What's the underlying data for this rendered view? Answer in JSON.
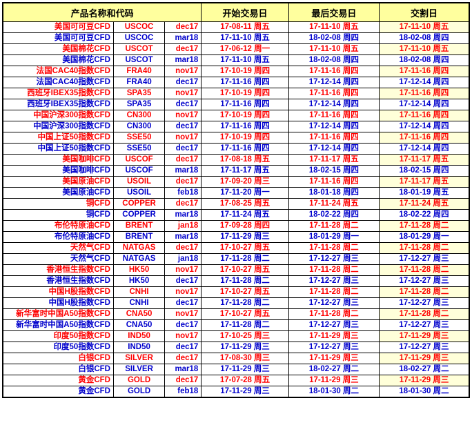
{
  "table": {
    "headers": {
      "product": "产品名称和代码",
      "start_trading_day": "开始交易日",
      "last_trading_day": "最后交易日",
      "settlement_day": "交割日"
    },
    "rows": [
      {
        "name": "美国可可豆CFD",
        "symbol": "USCOC",
        "month": "dec17",
        "start": "17-08-11 周五",
        "last": "17-11-10 周五",
        "settle": "17-11-10 周五",
        "color": "red"
      },
      {
        "name": "美国可可豆CFD",
        "symbol": "USCOC",
        "month": "mar18",
        "start": "17-11-10 周五",
        "last": "18-02-08 周四",
        "settle": "18-02-08 周四",
        "color": "blue"
      },
      {
        "name": "美国棉花CFD",
        "symbol": "USCOT",
        "month": "dec17",
        "start": "17-06-12 周一",
        "last": "17-11-10 周五",
        "settle": "17-11-10 周五",
        "color": "red"
      },
      {
        "name": "美国棉花CFD",
        "symbol": "USCOT",
        "month": "mar18",
        "start": "17-11-10 周五",
        "last": "18-02-08 周四",
        "settle": "18-02-08 周四",
        "color": "blue"
      },
      {
        "name": "法国CAC40指数CFD",
        "symbol": "FRA40",
        "month": "nov17",
        "start": "17-10-19 周四",
        "last": "17-11-16 周四",
        "settle": "17-11-16 周四",
        "color": "red"
      },
      {
        "name": "法国CAC40指数CFD",
        "symbol": "FRA40",
        "month": "dec17",
        "start": "17-11-16 周四",
        "last": "17-12-14 周四",
        "settle": "17-12-14 周四",
        "color": "blue"
      },
      {
        "name": "西班牙IBEX35指数CFD",
        "symbol": "SPA35",
        "month": "nov17",
        "start": "17-10-19 周四",
        "last": "17-11-16 周四",
        "settle": "17-11-16 周四",
        "color": "red"
      },
      {
        "name": "西班牙IBEX35指数CFD",
        "symbol": "SPA35",
        "month": "dec17",
        "start": "17-11-16 周四",
        "last": "17-12-14 周四",
        "settle": "17-12-14 周四",
        "color": "blue"
      },
      {
        "name": "中国沪深300指数CFD",
        "symbol": "CN300",
        "month": "nov17",
        "start": "17-10-19 周四",
        "last": "17-11-16 周四",
        "settle": "17-11-16 周四",
        "color": "red"
      },
      {
        "name": "中国沪深300指数CFD",
        "symbol": "CN300",
        "month": "dec17",
        "start": "17-11-16 周四",
        "last": "17-12-14 周四",
        "settle": "17-12-14 周四",
        "color": "blue"
      },
      {
        "name": "中国上证50指数CFD",
        "symbol": "SSE50",
        "month": "nov17",
        "start": "17-10-19 周四",
        "last": "17-11-16 周四",
        "settle": "17-11-16 周四",
        "color": "red"
      },
      {
        "name": "中国上证50指数CFD",
        "symbol": "SSE50",
        "month": "dec17",
        "start": "17-11-16 周四",
        "last": "17-12-14 周四",
        "settle": "17-12-14 周四",
        "color": "blue"
      },
      {
        "name": "美国咖啡CFD",
        "symbol": "USCOF",
        "month": "dec17",
        "start": "17-08-18 周五",
        "last": "17-11-17 周五",
        "settle": "17-11-17 周五",
        "color": "red"
      },
      {
        "name": "美国咖啡CFD",
        "symbol": "USCOF",
        "month": "mar18",
        "start": "17-11-17 周五",
        "last": "18-02-15 周四",
        "settle": "18-02-15 周四",
        "color": "blue"
      },
      {
        "name": "美国原油CFD",
        "symbol": "USOIL",
        "month": "dec17",
        "start": "17-09-20 周三",
        "last": "17-11-16 周四",
        "settle": "17-11-17 周五",
        "color": "red"
      },
      {
        "name": "美国原油CFD",
        "symbol": "USOIL",
        "month": "feb18",
        "start": "17-11-20 周一",
        "last": "18-01-18 周四",
        "settle": "18-01-19 周五",
        "color": "blue"
      },
      {
        "name": "铜CFD",
        "symbol": "COPPER",
        "month": "dec17",
        "start": "17-08-25 周五",
        "last": "17-11-24 周五",
        "settle": "17-11-24 周五",
        "color": "red"
      },
      {
        "name": "铜CFD",
        "symbol": "COPPER",
        "month": "mar18",
        "start": "17-11-24 周五",
        "last": "18-02-22 周四",
        "settle": "18-02-22 周四",
        "color": "blue"
      },
      {
        "name": "布伦特原油CFD",
        "symbol": "BRENT",
        "month": "jan18",
        "start": "17-09-28 周四",
        "last": "17-11-28 周二",
        "settle": "17-11-28 周二",
        "color": "red"
      },
      {
        "name": "布伦特原油CFD",
        "symbol": "BRENT",
        "month": "mar18",
        "start": "17-11-29 周三",
        "last": "18-01-29 周一",
        "settle": "18-01-29 周一",
        "color": "blue"
      },
      {
        "name": "天然气CFD",
        "symbol": "NATGAS",
        "month": "dec17",
        "start": "17-10-27 周五",
        "last": "17-11-28 周二",
        "settle": "17-11-28 周二",
        "color": "red"
      },
      {
        "name": "天然气CFD",
        "symbol": "NATGAS",
        "month": "jan18",
        "start": "17-11-28 周二",
        "last": "17-12-27 周三",
        "settle": "17-12-27 周三",
        "color": "blue"
      },
      {
        "name": "香港恒生指数CFD",
        "symbol": "HK50",
        "month": "nov17",
        "start": "17-10-27 周五",
        "last": "17-11-28 周二",
        "settle": "17-11-28 周二",
        "color": "red"
      },
      {
        "name": "香港恒生指数CFD",
        "symbol": "HK50",
        "month": "dec17",
        "start": "17-11-28 周二",
        "last": "17-12-27 周三",
        "settle": "17-12-27 周三",
        "color": "blue"
      },
      {
        "name": "中国H股指数CFD",
        "symbol": "CNHI",
        "month": "nov17",
        "start": "17-10-27 周五",
        "last": "17-11-28 周二",
        "settle": "17-11-28 周二",
        "color": "red"
      },
      {
        "name": "中国H股指数CFD",
        "symbol": "CNHI",
        "month": "dec17",
        "start": "17-11-28 周二",
        "last": "17-12-27 周三",
        "settle": "17-12-27 周三",
        "color": "blue"
      },
      {
        "name": "新华富时中国A50指数CFD",
        "symbol": "CNA50",
        "month": "nov17",
        "start": "17-10-27 周五",
        "last": "17-11-28 周二",
        "settle": "17-11-28 周二",
        "color": "red"
      },
      {
        "name": "新华富时中国A50指数CFD",
        "symbol": "CNA50",
        "month": "dec17",
        "start": "17-11-28 周二",
        "last": "17-12-27 周三",
        "settle": "17-12-27 周三",
        "color": "blue"
      },
      {
        "name": "印度50指数CFD",
        "symbol": "IND50",
        "month": "nov17",
        "start": "17-10-25 周三",
        "last": "17-11-29 周三",
        "settle": "17-11-29 周三",
        "color": "red"
      },
      {
        "name": "印度50指数CFD",
        "symbol": "IND50",
        "month": "dec17",
        "start": "17-11-29 周三",
        "last": "17-12-27 周三",
        "settle": "17-12-27 周三",
        "color": "blue"
      },
      {
        "name": "白银CFD",
        "symbol": "SILVER",
        "month": "dec17",
        "start": "17-08-30 周三",
        "last": "17-11-29 周三",
        "settle": "17-11-29 周三",
        "color": "red"
      },
      {
        "name": "白银CFD",
        "symbol": "SILVER",
        "month": "mar18",
        "start": "17-11-29 周三",
        "last": "18-02-27 周二",
        "settle": "18-02-27 周二",
        "color": "blue"
      },
      {
        "name": "黄金CFD",
        "symbol": "GOLD",
        "month": "dec17",
        "start": "17-07-28 周五",
        "last": "17-11-29 周三",
        "settle": "17-11-29 周三",
        "color": "red"
      },
      {
        "name": "黄金CFD",
        "symbol": "GOLD",
        "month": "feb18",
        "start": "17-11-29 周三",
        "last": "18-01-30 周二",
        "settle": "18-01-30 周二",
        "color": "blue"
      }
    ],
    "colors": {
      "header_bg": "#ffff9e",
      "expiring_text": "#ff0000",
      "next_text": "#0000cc",
      "settle_highlight_bg": "#ffffd9",
      "border": "#000000"
    }
  }
}
